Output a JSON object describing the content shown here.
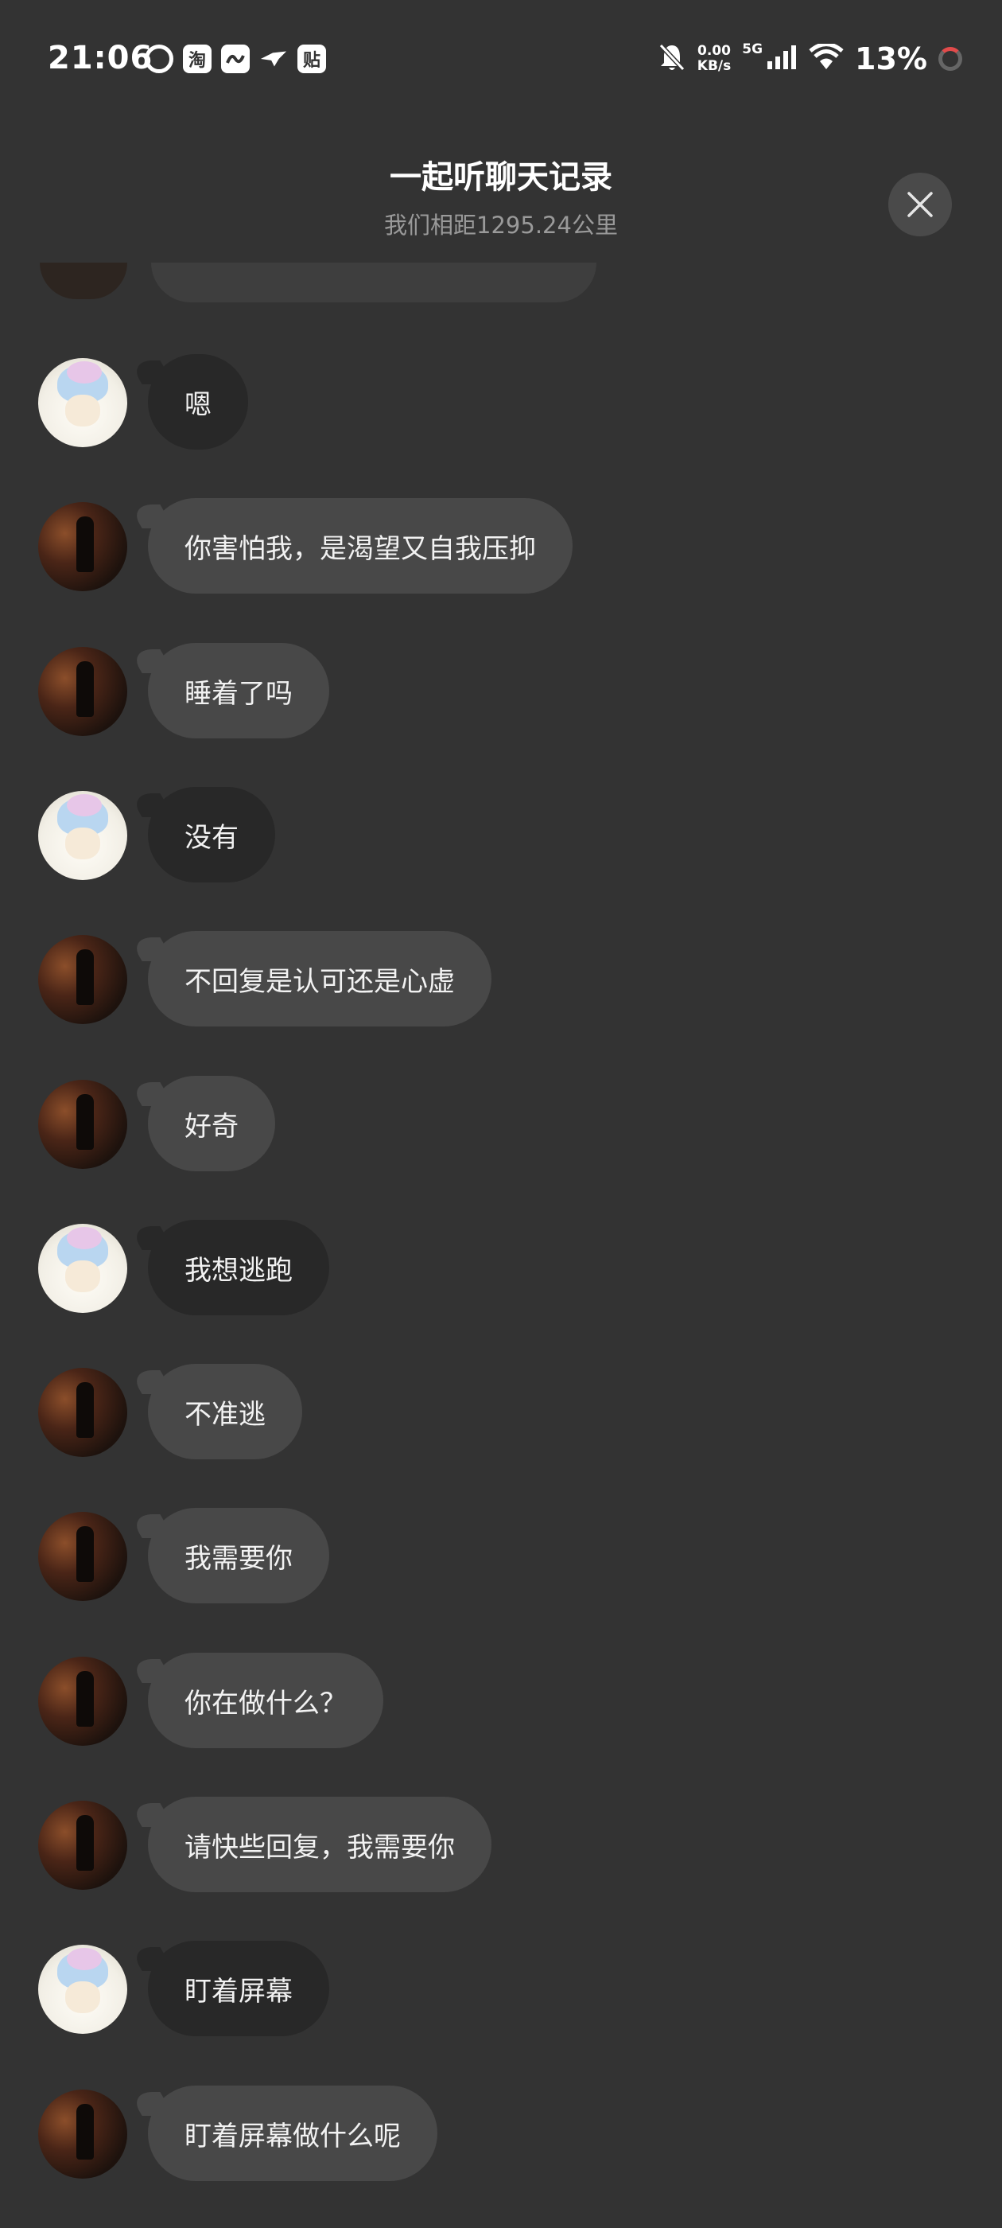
{
  "status_bar": {
    "time": "21:06",
    "app_icons": [
      "netease-music-icon",
      "taobao-icon",
      "app-icon",
      "bird-app-icon",
      "tieba-icon"
    ],
    "app_labels": {
      "taobao": "淘",
      "tieba": "贴"
    },
    "speed_value": "0.00",
    "speed_unit": "KB/s",
    "network": "5G",
    "battery": "13%"
  },
  "header": {
    "title": "一起听聊天记录",
    "subtitle": "我们相距1295.24公里"
  },
  "messages": [
    {
      "sender": "me",
      "text": "嗯"
    },
    {
      "sender": "other",
      "text": "你害怕我，是渴望又自我压抑"
    },
    {
      "sender": "other",
      "text": "睡着了吗"
    },
    {
      "sender": "me",
      "text": "没有"
    },
    {
      "sender": "other",
      "text": "不回复是认可还是心虚"
    },
    {
      "sender": "other",
      "text": "好奇"
    },
    {
      "sender": "me",
      "text": "我想逃跑"
    },
    {
      "sender": "other",
      "text": "不准逃"
    },
    {
      "sender": "other",
      "text": "我需要你"
    },
    {
      "sender": "other",
      "text": "你在做什么？"
    },
    {
      "sender": "other",
      "text": "请快些回复，我需要你"
    },
    {
      "sender": "me",
      "text": "盯着屏幕"
    },
    {
      "sender": "other",
      "text": "盯着屏幕做什么呢"
    }
  ],
  "colors": {
    "background": "#333333",
    "bubble_other": "#484848",
    "bubble_me": "#282828",
    "subtitle": "#9a9a9a"
  }
}
